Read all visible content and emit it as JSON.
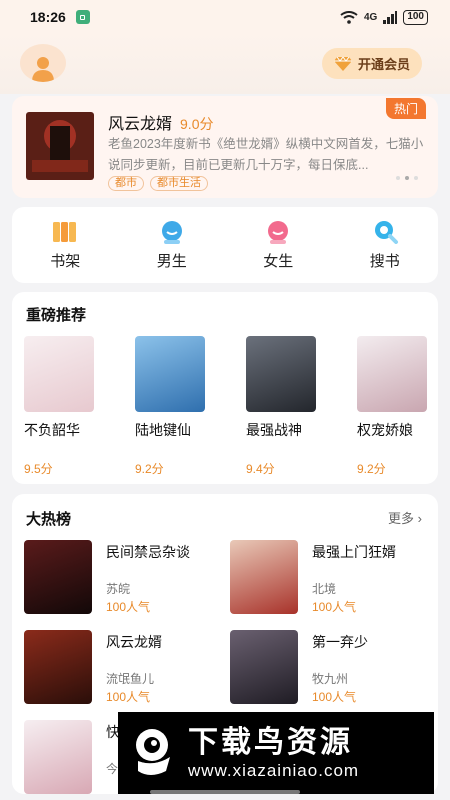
{
  "status": {
    "time": "18:26",
    "network": "4G",
    "battery": "100"
  },
  "header": {
    "vip_label": "开通会员"
  },
  "banner": {
    "title": "风云龙婿",
    "score": "9.0分",
    "badge": "热门",
    "description": "老鱼2023年度新书《绝世龙婿》纵横中文网首发，七猫小说同步更新，目前已更新几十万字，每日保底...",
    "tags": [
      "都市",
      "都市生活"
    ]
  },
  "nav": [
    {
      "label": "书架",
      "icon": "bookshelf-icon"
    },
    {
      "label": "男生",
      "icon": "male-icon"
    },
    {
      "label": "女生",
      "icon": "female-icon"
    },
    {
      "label": "搜书",
      "icon": "search-icon"
    }
  ],
  "featured": {
    "title": "重磅推荐",
    "books": [
      {
        "name": "不负韶华",
        "score": "9.5分",
        "cover_color": "#f4e8ea"
      },
      {
        "name": "陆地键仙",
        "score": "9.2分",
        "cover_color": "#4f8ec7"
      },
      {
        "name": "最强战神",
        "score": "9.4分",
        "cover_color": "#3a3f48"
      },
      {
        "name": "权宠娇娘",
        "score": "9.2分",
        "cover_color": "#e9dde0"
      }
    ]
  },
  "hotlist": {
    "title": "大热榜",
    "more_label": "更多",
    "books": [
      {
        "name": "民间禁忌杂谈",
        "author": "苏皖",
        "popularity": "100人气",
        "cover_color": "#2a1414"
      },
      {
        "name": "最强上门狂婿",
        "author": "北境",
        "popularity": "100人气",
        "cover_color": "#b8473a"
      },
      {
        "name": "风云龙婿",
        "author": "流氓鱼儿",
        "popularity": "100人气",
        "cover_color": "#5a1f16"
      },
      {
        "name": "第一弃少",
        "author": "牧九州",
        "popularity": "100人气",
        "cover_color": "#3a3540"
      },
      {
        "name": "快",
        "author": "今",
        "popularity": "",
        "cover_color": "#efe6ea"
      }
    ]
  },
  "watermark": {
    "title": "下载鸟资源",
    "url": "www.xiazainiao.com"
  },
  "colors": {
    "accent": "#e88a2b",
    "hot_badge": "#f3772f",
    "header_bg": "#fdf3ec"
  }
}
